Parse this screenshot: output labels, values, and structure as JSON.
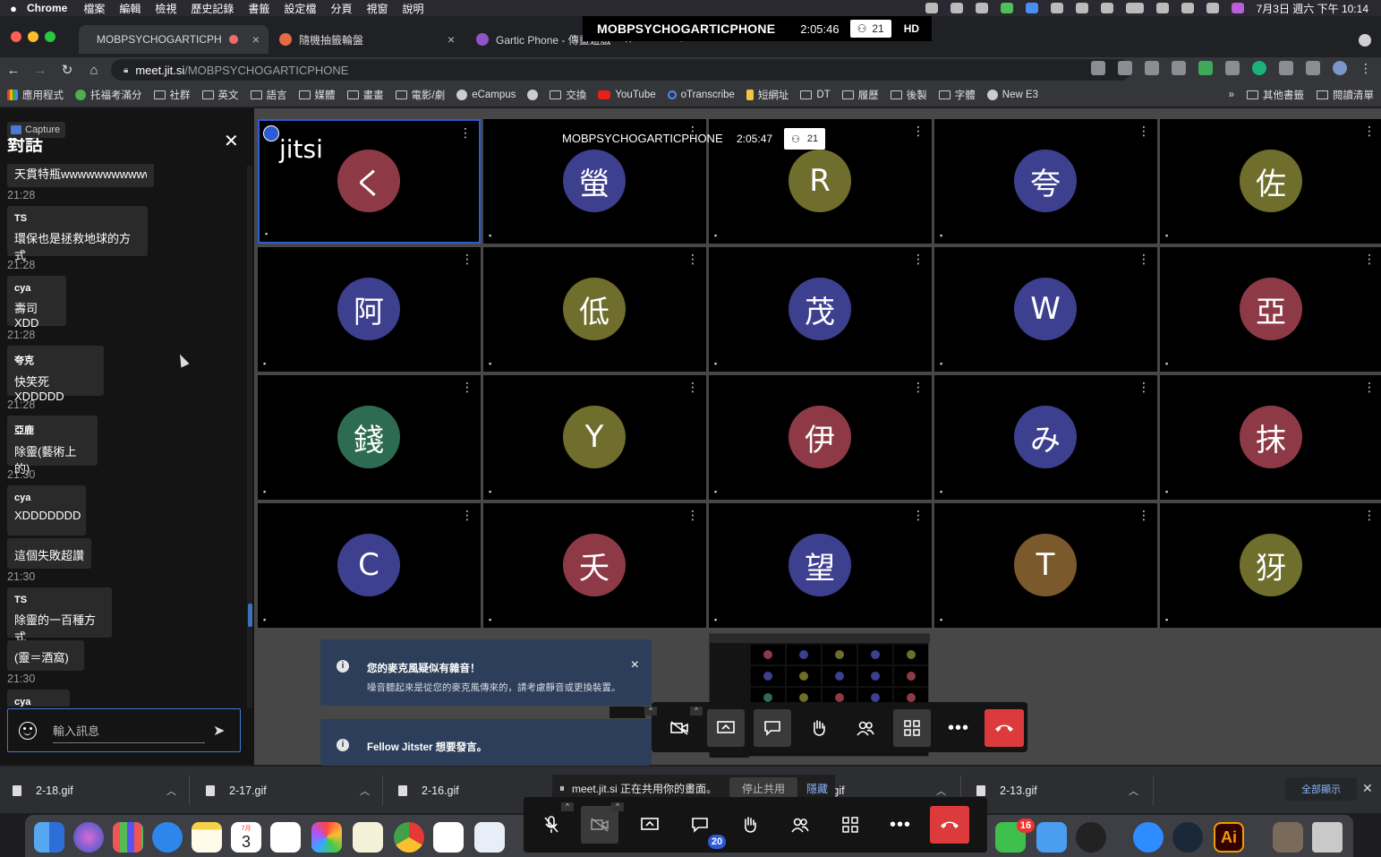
{
  "menubar": {
    "app_name": "Chrome",
    "menus": [
      "檔案",
      "編輯",
      "檢視",
      "歷史記錄",
      "書籤",
      "設定檔",
      "分頁",
      "視窗",
      "說明"
    ],
    "clock": "7月3日 週六 下午 10:14"
  },
  "sharebar": {
    "title": "MOBPSYCHOGARTICPHONE",
    "time": "2:05:46",
    "participants": "21",
    "quality": "HD"
  },
  "tabs": [
    {
      "label": "MOBPSYCHOGARTICPHO",
      "color": "#3d3d3d"
    },
    {
      "label": "隨機抽籤輪盤",
      "color": "#e46b46"
    },
    {
      "label": "Gartic Phone - 傳畫遊戲",
      "color": "#8f55c7"
    }
  ],
  "address": {
    "host": "meet.jit.si",
    "path": "/MOBPSYCHOGARTICPHONE"
  },
  "bookmarks": [
    {
      "label": "應用程式",
      "type": "apps"
    },
    {
      "label": "托福考滿分",
      "type": "site"
    },
    {
      "label": "社群",
      "type": "folder"
    },
    {
      "label": "英文",
      "type": "folder"
    },
    {
      "label": "語言",
      "type": "folder"
    },
    {
      "label": "媒體",
      "type": "folder"
    },
    {
      "label": "畫畫",
      "type": "folder"
    },
    {
      "label": "電影/劇",
      "type": "folder"
    },
    {
      "label": "eCampus",
      "type": "site"
    },
    {
      "label": "",
      "type": "site"
    },
    {
      "label": "交換",
      "type": "folder"
    },
    {
      "label": "YouTube",
      "type": "site"
    },
    {
      "label": "oTranscribe",
      "type": "site"
    },
    {
      "label": "短網址",
      "type": "site"
    },
    {
      "label": "DT",
      "type": "folder"
    },
    {
      "label": "履歷",
      "type": "folder"
    },
    {
      "label": "後製",
      "type": "folder"
    },
    {
      "label": "字體",
      "type": "folder"
    },
    {
      "label": "New E3",
      "type": "site"
    }
  ],
  "bookmarks_right": {
    "more": "»",
    "other": "其他書籤",
    "reading": "閱讀清單"
  },
  "chat": {
    "title": "對話",
    "capture_label": "Capture",
    "truncated_top": "天貫特瓶wwwwwwwwwwww",
    "messages": [
      {
        "time": "21:28",
        "sender": "TS",
        "text": "環保也是拯救地球的方式"
      },
      {
        "time": "21:28",
        "sender": "cya",
        "text": "壽司XDD"
      },
      {
        "time": "21:28",
        "sender": "夸克",
        "text": "快笑死XDDDDD"
      },
      {
        "time": "21:28",
        "sender": "亞鹿",
        "text": "除靈(藝術上的)"
      },
      {
        "time": "21:30",
        "sender": "cya",
        "text": "XDDDDDDD",
        "extra": "這個失敗超讚"
      },
      {
        "time": "21:30",
        "sender": "TS",
        "text": "除靈的一百種方式",
        "extra": "(靈＝酒窩)"
      },
      {
        "time": "21:30",
        "sender": "cya",
        "text": ""
      }
    ],
    "input_placeholder": "輸入訊息"
  },
  "meeting": {
    "logo": "jitsi",
    "inner_title": "MOBPSYCHOGARTICPHONE",
    "inner_time": "2:05:47",
    "inner_count": "21",
    "tiles": [
      {
        "initial": "く",
        "color": "#8e3a46",
        "selected": true
      },
      {
        "initial": "螢",
        "color": "#3d3f8f"
      },
      {
        "initial": "R",
        "color": "#6f6e2c"
      },
      {
        "initial": "夸",
        "color": "#3d3f8f"
      },
      {
        "initial": "佐",
        "color": "#6f6e2c"
      },
      {
        "initial": "阿",
        "color": "#3d3f8f"
      },
      {
        "initial": "低",
        "color": "#6f6e2c"
      },
      {
        "initial": "茂",
        "color": "#3d3f8f"
      },
      {
        "initial": "W",
        "color": "#3d3f8f"
      },
      {
        "initial": "亞",
        "color": "#8e3a46"
      },
      {
        "initial": "錢",
        "color": "#2e6b53"
      },
      {
        "initial": "Y",
        "color": "#6f6e2c"
      },
      {
        "initial": "伊",
        "color": "#8e3a46"
      },
      {
        "initial": "み",
        "color": "#3d3f8f"
      },
      {
        "initial": "抹",
        "color": "#8e3a46"
      },
      {
        "initial": "C",
        "color": "#3d3f8f"
      },
      {
        "initial": "夭",
        "color": "#8e3a46"
      },
      {
        "initial": "望",
        "color": "#3d3f8f"
      },
      {
        "initial": "T",
        "color": "#7a5a2c"
      },
      {
        "initial": "犽",
        "color": "#6f6e2c"
      }
    ],
    "notifications": [
      {
        "title": "您的麥克風疑似有雜音！",
        "desc": "噪音聽起來是從您的麥克風傳來的，請考慮靜音或更換裝置。"
      },
      {
        "title": "Fellow Jitster 想要發言。",
        "desc": ""
      }
    ],
    "participants_badge": "20"
  },
  "downloads": [
    {
      "name": "2-18.gif"
    },
    {
      "name": "2-17.gif"
    },
    {
      "name": "2-16.gif"
    },
    {
      "name": "1.gif"
    },
    {
      "name": "2-13.gif"
    }
  ],
  "share_banner": {
    "text": "meet.jit.si 正在共用你的畫面。",
    "stop": "停止共用",
    "hide": "隱藏"
  },
  "show_all": "全部顯示",
  "dock": {
    "calendar_day": "3",
    "calendar_month": "7月",
    "line_badge": "16",
    "ai_label": "Ai"
  }
}
